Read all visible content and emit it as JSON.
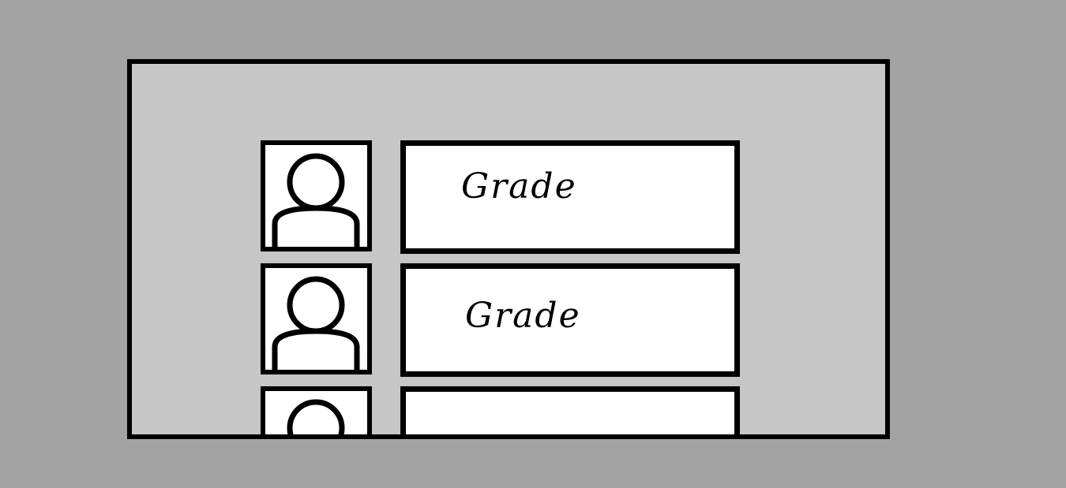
{
  "grade_list": {
    "items": [
      {
        "label": "Grade",
        "avatar_icon": "user-icon"
      },
      {
        "label": "Grade",
        "avatar_icon": "user-icon"
      },
      {
        "label": "",
        "avatar_icon": "user-icon"
      }
    ]
  },
  "colors": {
    "background": "#a3a3a3",
    "panel": "#c6c6c6",
    "box": "#ffffff",
    "stroke": "#000000"
  }
}
